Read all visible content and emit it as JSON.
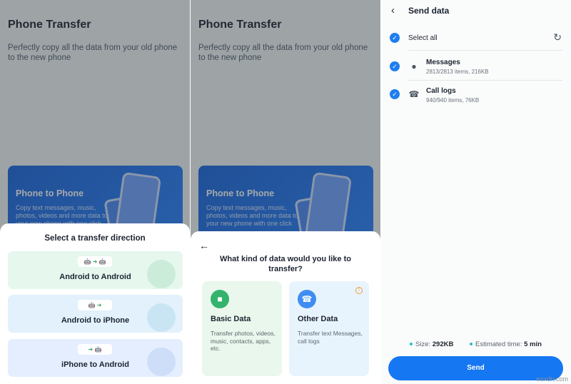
{
  "panel1": {
    "title": "Phone Transfer",
    "subtitle": "Perfectly copy all the data from your old phone to the new phone",
    "banner_title": "Phone to Phone",
    "banner_desc": "Copy text messages, music, photos, videos and more data to your new phone with one click",
    "sheet_title": "Select a transfer direction",
    "directions": [
      {
        "label": "Android to Android",
        "icons": "🤖 ➜ 🤖"
      },
      {
        "label": "Android to iPhone",
        "icons": "🤖 ➜ "
      },
      {
        "label": "iPhone to Android",
        "icons": " ➜ 🤖"
      }
    ]
  },
  "panel2": {
    "title": "Phone Transfer",
    "subtitle": "Perfectly copy all the data from your old phone to the new phone",
    "banner_title": "Phone to Phone",
    "banner_desc": "Copy text messages, music, photos, videos and more data to your new phone with one click",
    "question": "What kind of data would you like to transfer?",
    "basic": {
      "title": "Basic Data",
      "desc": "Transfer photos, videos, music, contacts, apps, etc."
    },
    "other": {
      "title": "Other Data",
      "desc": "Transfer text Messages, call logs"
    }
  },
  "panel3": {
    "header": "Send data",
    "select_all": "Select all",
    "items": [
      {
        "title": "Messages",
        "sub": "2813/2813 items, 216KB"
      },
      {
        "title": "Call logs",
        "sub": "940/940 items, 76KB"
      }
    ],
    "size_label": "Size:",
    "size_value": "292KB",
    "time_label": "Estimated time:",
    "time_value": "5 min",
    "send_label": "Send"
  },
  "watermark": "wsxdn.com",
  "colors": {
    "accent": "#1677f2",
    "green": "#33b36c",
    "warning": "#f29b3b"
  }
}
